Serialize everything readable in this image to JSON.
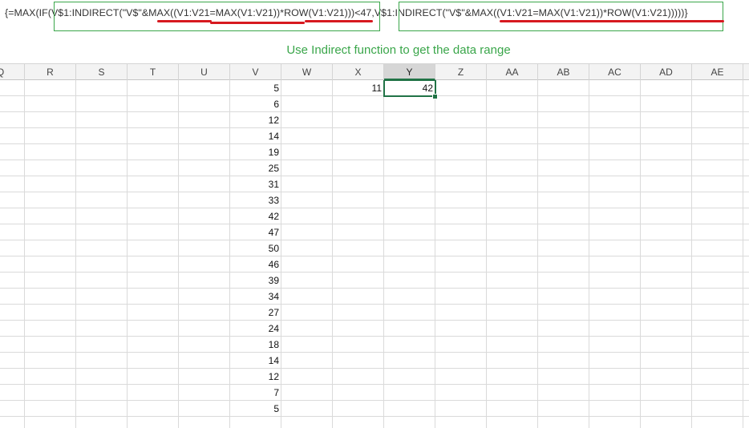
{
  "formula_bar": {
    "formula": "{=MAX(IF(V$1:INDIRECT(\"V$\"&MAX((V1:V21=MAX(V1:V21))*ROW(V1:V21)))<47,V$1:INDIRECT(\"V$\"&MAX((V1:V21=MAX(V1:V21))*ROW(V1:V21)))))}"
  },
  "annotation": "Use Indirect function to get the data range",
  "columns": [
    "Q",
    "R",
    "S",
    "T",
    "U",
    "V",
    "W",
    "X",
    "Y",
    "Z",
    "AA",
    "AB",
    "AC",
    "AD",
    "AE"
  ],
  "selected_column": "Y",
  "column_v_values": [
    "5",
    "6",
    "12",
    "14",
    "19",
    "25",
    "31",
    "33",
    "42",
    "47",
    "50",
    "46",
    "39",
    "34",
    "27",
    "24",
    "18",
    "14",
    "12",
    "7",
    "5"
  ],
  "cell_x1": "11",
  "cell_y1": "42",
  "colors": {
    "accent_green": "#3aa64a",
    "underline_red": "#d71920",
    "selection_green": "#217346"
  }
}
